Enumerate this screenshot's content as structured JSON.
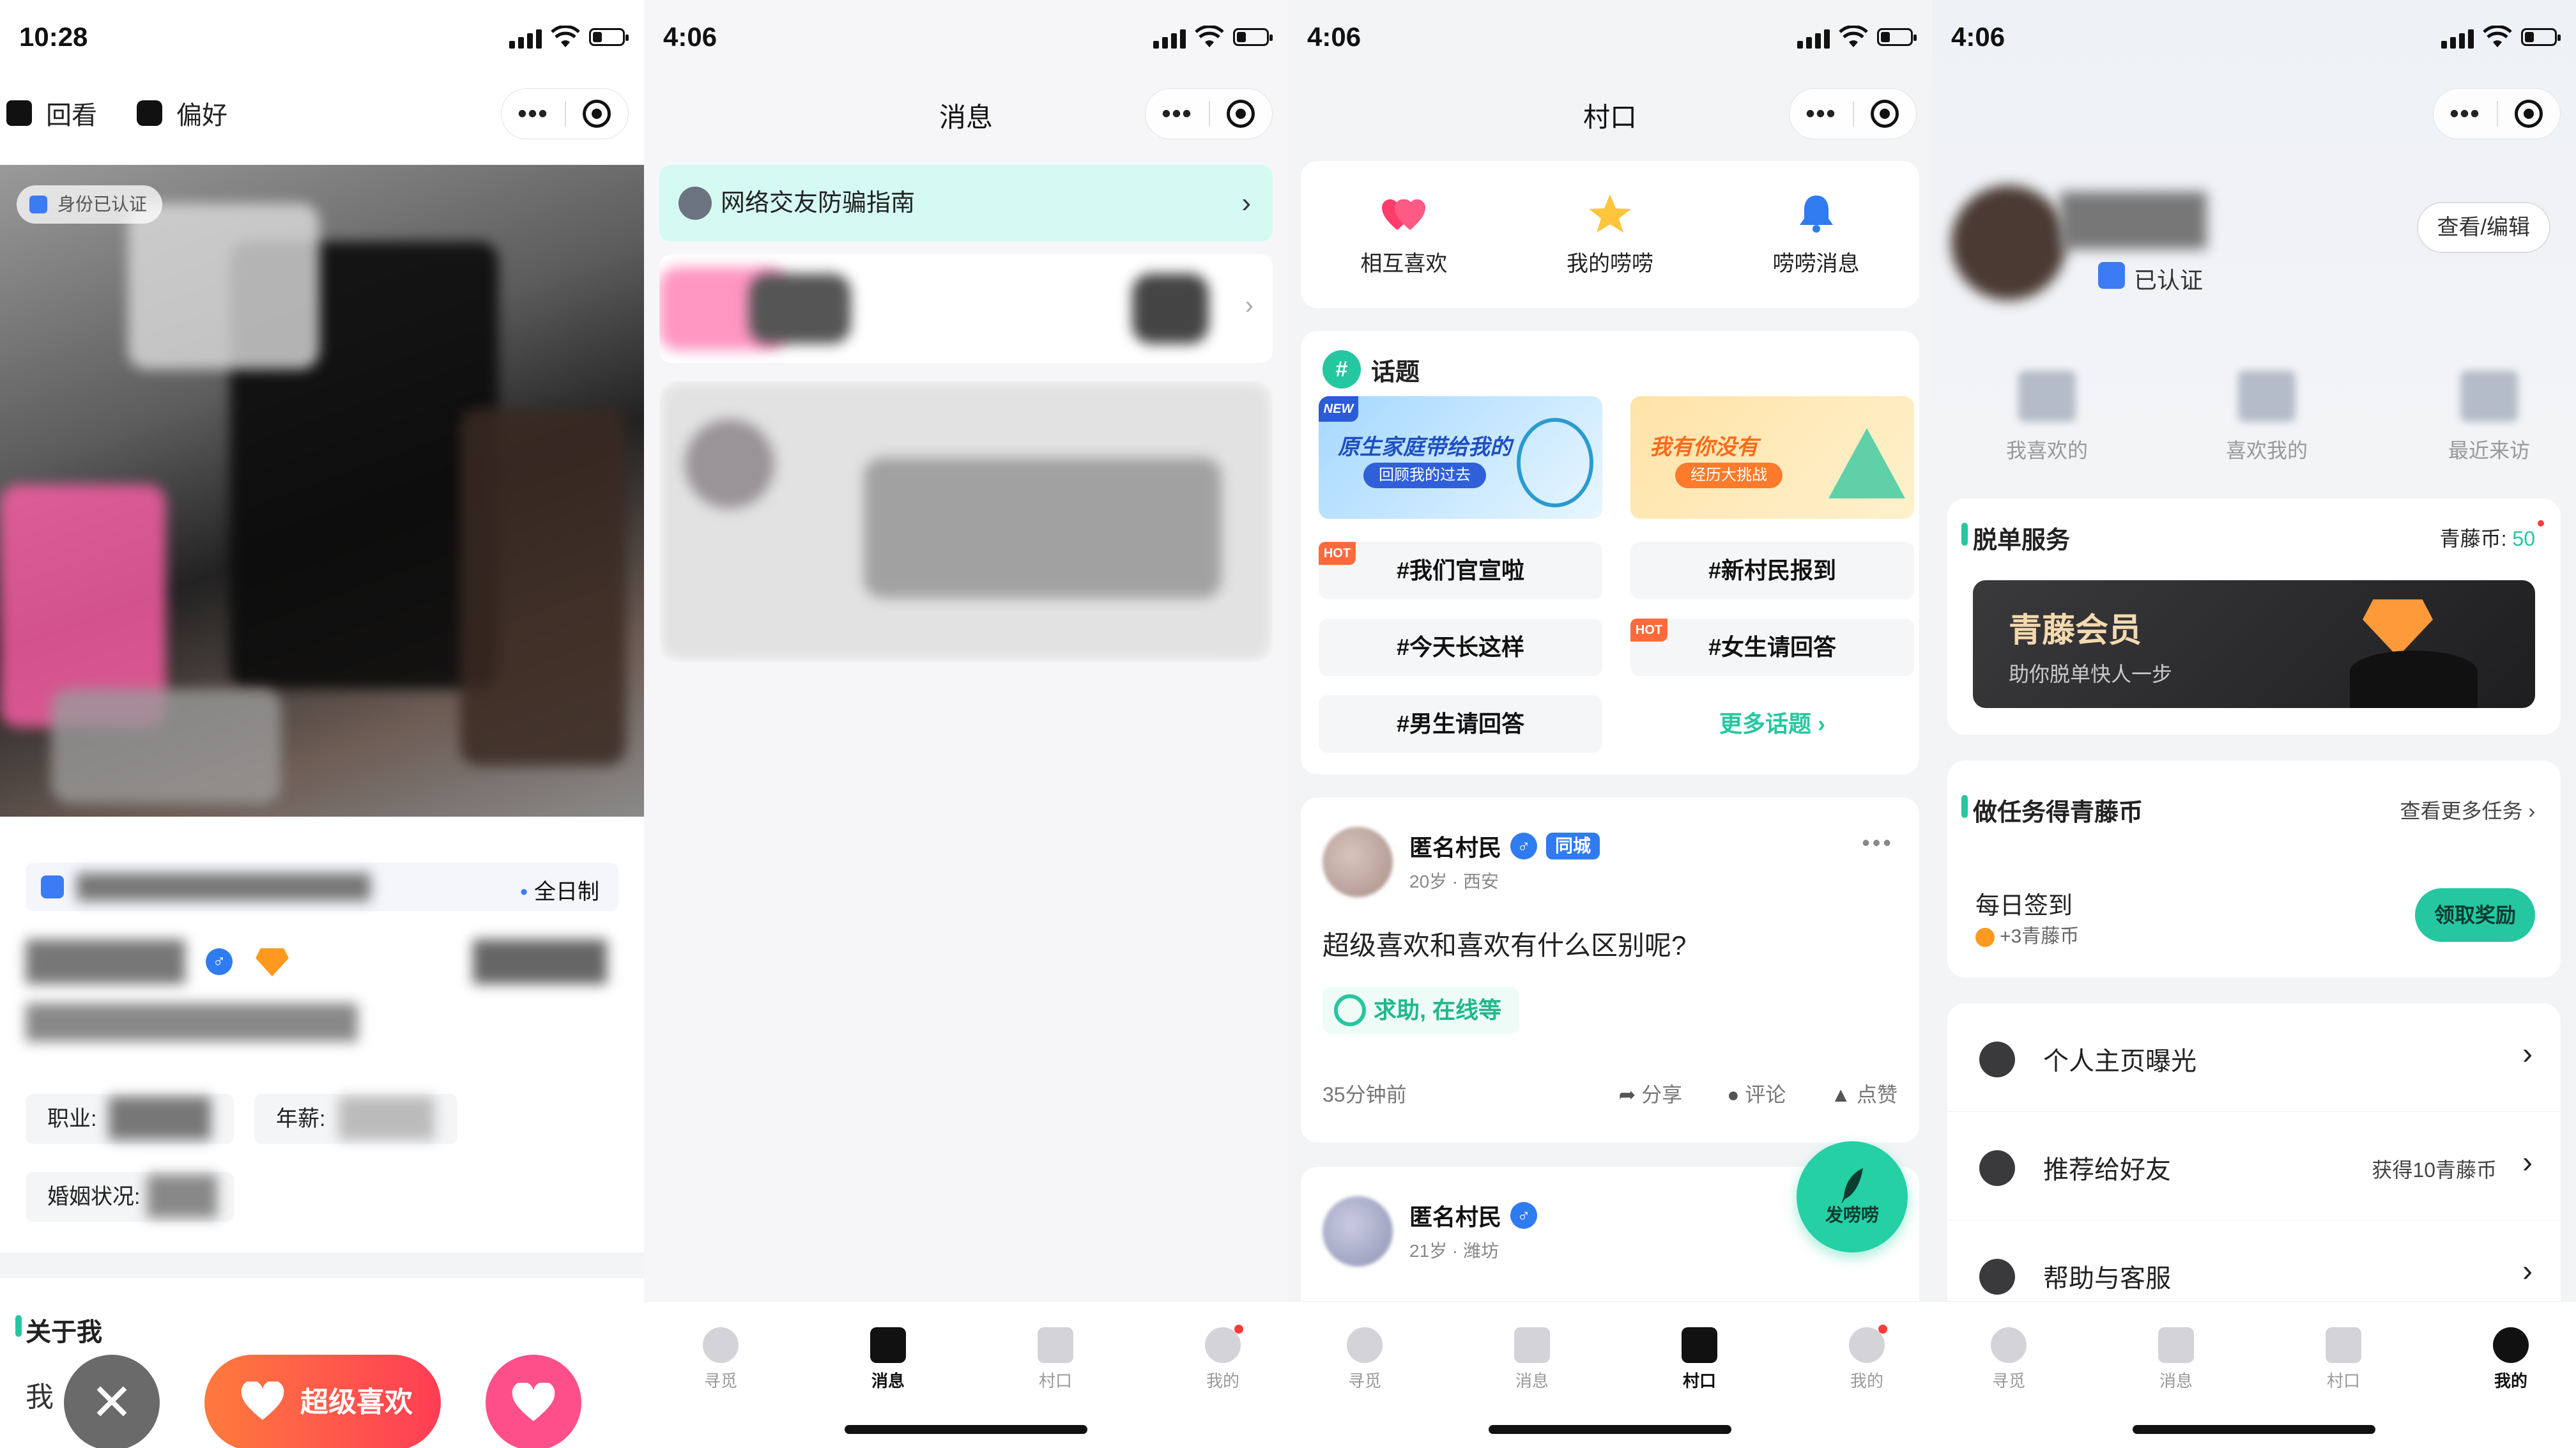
{
  "panels": {
    "p1": {
      "time": "10:28",
      "top_actions": {
        "replay": "回看",
        "preference": "偏好"
      },
      "verified_pill": "身份已认证",
      "schedule": "全日制",
      "labels": {
        "job": "职业:",
        "salary": "年薪:",
        "marital": "婚姻状况:"
      },
      "about_title": "关于我",
      "about_text": "我",
      "super_like": "超级喜欢",
      "close_glyph": "✕"
    },
    "p2": {
      "time": "4:06",
      "title": "消息",
      "guide": "网络交友防骗指南"
    },
    "p3": {
      "time": "4:06",
      "title": "村口",
      "quick": [
        {
          "label": "相互喜欢"
        },
        {
          "label": "我的唠唠"
        },
        {
          "label": "唠唠消息"
        }
      ],
      "topic_title": "话题",
      "banners": [
        {
          "tag": "NEW",
          "title": "原生家庭带给我的",
          "sub": "回顾我的过去",
          "color": "#3d7bf5"
        },
        {
          "tag": "",
          "title": "我有你没有",
          "sub": "经历大挑战",
          "color": "#ff8a2a"
        }
      ],
      "chips": [
        {
          "text": "#我们官宣啦",
          "hot": "HOT"
        },
        {
          "text": "#新村民报到",
          "hot": ""
        },
        {
          "text": "#今天长这样",
          "hot": ""
        },
        {
          "text": "#女生请回答",
          "hot": "HOT"
        },
        {
          "text": "#男生请回答",
          "hot": ""
        }
      ],
      "more_topics": "更多话题 ›",
      "posts": [
        {
          "name": "匿名村民",
          "gender": "♂",
          "tag": "同城",
          "meta": "20岁 · 西安",
          "body": "超级喜欢和喜欢有什么区别呢?",
          "help": "求助, 在线等",
          "time": "35分钟前"
        },
        {
          "name": "匿名村民",
          "gender": "♂",
          "tag": "",
          "meta": "21岁 · 潍坊"
        }
      ],
      "actions": {
        "share": "分享",
        "comment": "评论",
        "like": "点赞"
      },
      "fab_label": "发唠唠"
    },
    "p4": {
      "time": "4:06",
      "view_edit": "查看/编辑",
      "verified": "已认证",
      "stats": [
        {
          "label": "我喜欢的"
        },
        {
          "label": "喜欢我的"
        },
        {
          "label": "最近来访"
        }
      ],
      "service_title": "脱单服务",
      "coins_label": "青藤币:",
      "coins_value": "50",
      "vip_title": "青藤会员",
      "vip_sub": "助你脱单快人一步",
      "task_title": "做任务得青藤币",
      "task_more": "查看更多任务 ›",
      "daily_title": "每日签到",
      "daily_reward": "+3青藤币",
      "claim": "领取奖励",
      "menu": [
        {
          "label": "个人主页曝光",
          "right": ""
        },
        {
          "label": "推荐给好友",
          "right": "获得10青藤币"
        },
        {
          "label": "帮助与客服",
          "right": ""
        }
      ]
    }
  },
  "tabbar": [
    "寻觅",
    "消息",
    "村口",
    "我的"
  ],
  "colors": {
    "accent": "#25c7a0",
    "blue": "#3d7bf5",
    "hot": "#ff6a3d",
    "like": "#ff4f8a"
  }
}
